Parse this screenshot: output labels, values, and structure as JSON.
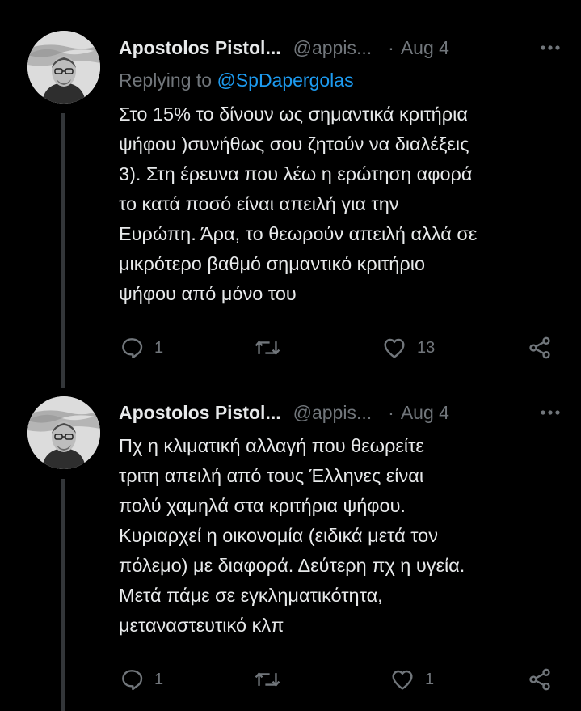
{
  "tweets": [
    {
      "name": "Apostolos Pistol...",
      "handle": "@appis...",
      "separator": "·",
      "time": "Aug 4",
      "replying_prefix": "Replying to ",
      "replying_mention": "@SpDapergolas",
      "lines": [
        "Στο 15% το δίνουν ως σημαντικά κριτήρια",
        "ψήφου )συνήθως σου ζητούν να διαλέξεις",
        "3). Στη έρευνα που λέω η ερώτηση αφορά",
        "το κατά ποσό είναι απειλή για την",
        "Ευρώπη. Άρα, το θεωρούν απειλή αλλά σε",
        "μικρότερο βαθμό σημαντικό κριτήριο",
        "ψήφου από μόνο του"
      ],
      "actions": {
        "reply_count": "1",
        "retweet_count": "",
        "like_count": "13"
      }
    },
    {
      "name": "Apostolos Pistol...",
      "handle": "@appis...",
      "separator": "·",
      "time": "Aug 4",
      "lines": [
        "Πχ η κλιματική αλλαγή που θεωρείτε",
        "τριτη απειλή από τους Έλληνες είναι",
        "πολύ χαμηλά στα κριτήρια ψήφου.",
        "Κυριαρχεί η οικονομία (ειδικά μετά τον",
        "πόλεμο) με διαφορά. Δεύτερη πχ η υγεία.",
        "Μετά πάμε σε εγκληματικότητα,",
        "μεταναστευτικό κλπ"
      ],
      "actions": {
        "reply_count": "1",
        "retweet_count": "",
        "like_count": "1"
      }
    }
  ],
  "icons": {
    "more": "more-horizontal-icon",
    "reply": "reply-icon",
    "retweet": "retweet-icon",
    "like": "heart-icon",
    "share": "share-icon"
  },
  "colors": {
    "background": "#000000",
    "text": "#e7e9ea",
    "secondary": "#71767b",
    "link": "#1d9bf0",
    "thread_line": "#333639"
  }
}
